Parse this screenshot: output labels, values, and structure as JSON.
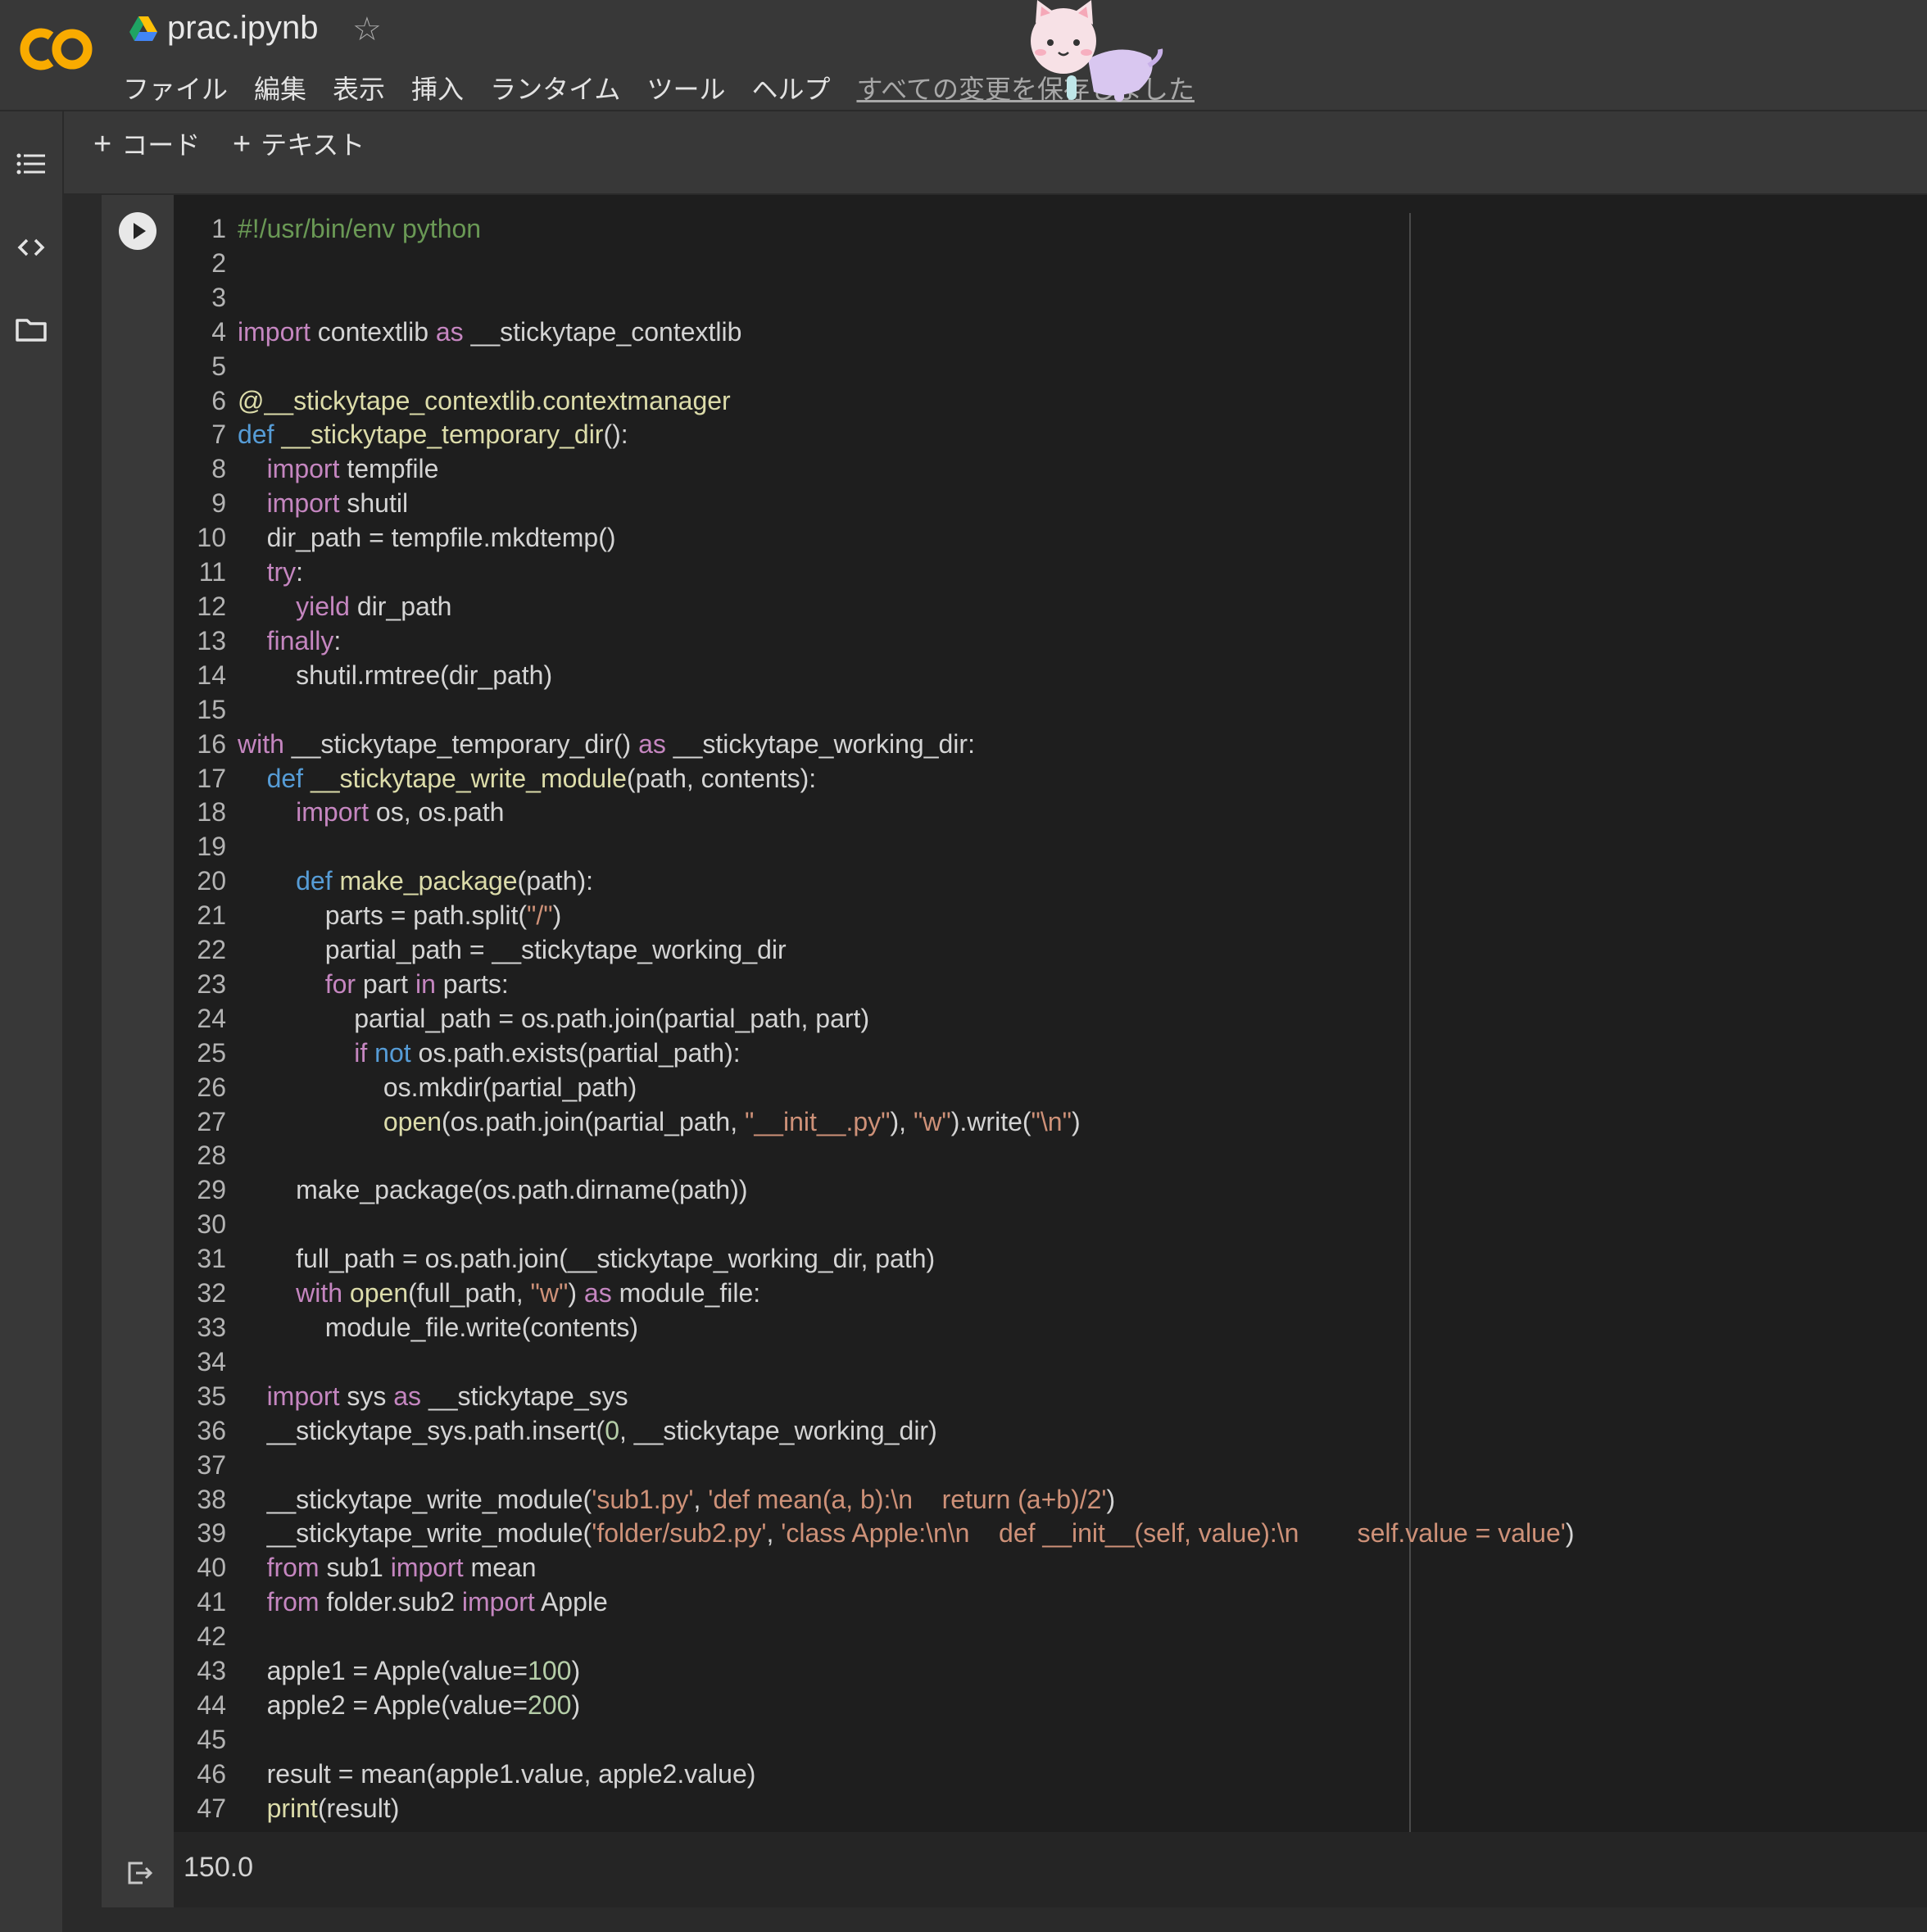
{
  "header": {
    "notebook_title": "prac.ipynb",
    "menu": [
      "ファイル",
      "編集",
      "表示",
      "挿入",
      "ランタイム",
      "ツール",
      "ヘルプ"
    ],
    "save_status": "すべての変更を保存しました"
  },
  "toolbar": {
    "add_code_label": "コード",
    "add_text_label": "テキスト"
  },
  "left_rail": {
    "icons": [
      "list-icon",
      "code-brackets-icon",
      "folder-icon"
    ]
  },
  "colors": {
    "background": "#383838",
    "editor": "#1e1e1e",
    "logo_orange": "#F9AB00"
  },
  "cell": {
    "code_lines": [
      "#!/usr/bin/env python",
      "",
      "",
      "import contextlib as __stickytape_contextlib",
      "",
      "@__stickytape_contextlib.contextmanager",
      "def __stickytape_temporary_dir():",
      "    import tempfile",
      "    import shutil",
      "    dir_path = tempfile.mkdtemp()",
      "    try:",
      "        yield dir_path",
      "    finally:",
      "        shutil.rmtree(dir_path)",
      "",
      "with __stickytape_temporary_dir() as __stickytape_working_dir:",
      "    def __stickytape_write_module(path, contents):",
      "        import os, os.path",
      "",
      "        def make_package(path):",
      "            parts = path.split(\"/\")",
      "            partial_path = __stickytape_working_dir",
      "            for part in parts:",
      "                partial_path = os.path.join(partial_path, part)",
      "                if not os.path.exists(partial_path):",
      "                    os.mkdir(partial_path)",
      "                    open(os.path.join(partial_path, \"__init__.py\"), \"w\").write(\"\\n\")",
      "",
      "        make_package(os.path.dirname(path))",
      "",
      "        full_path = os.path.join(__stickytape_working_dir, path)",
      "        with open(full_path, \"w\") as module_file:",
      "            module_file.write(contents)",
      "",
      "    import sys as __stickytape_sys",
      "    __stickytape_sys.path.insert(0, __stickytape_working_dir)",
      "",
      "    __stickytape_write_module('sub1.py', 'def mean(a, b):\\n    return (a+b)/2')",
      "    __stickytape_write_module('folder/sub2.py', 'class Apple:\\n\\n    def __init__(self, value):\\n        self.value = value')",
      "    from sub1 import mean",
      "    from folder.sub2 import Apple",
      "",
      "    apple1 = Apple(value=100)",
      "    apple2 = Apple(value=200)",
      "",
      "    result = mean(apple1.value, apple2.value)",
      "    print(result)"
    ],
    "output": "150.0"
  }
}
